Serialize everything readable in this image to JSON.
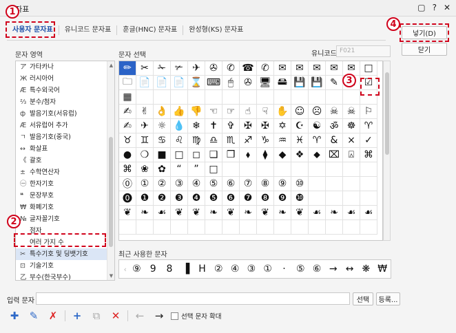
{
  "window": {
    "title": "문자표",
    "help_icon_label": "?"
  },
  "tabs": [
    {
      "label": "사용자 문자표"
    },
    {
      "label": "유니코드 문자표"
    },
    {
      "label": "훈글(HNC) 문자표"
    },
    {
      "label": "완성형(KS) 문자표"
    }
  ],
  "area_label": "문자 영역",
  "select_label": "문자 선택",
  "unicode": {
    "label": "유니코드",
    "value": "F021"
  },
  "categories": [
    {
      "icon": "ア",
      "label": "가타카나"
    },
    {
      "icon": "Ж",
      "label": "러시아어"
    },
    {
      "icon": "Æ",
      "label": "특수외국어"
    },
    {
      "icon": "⅔",
      "label": "분수/첨자"
    },
    {
      "icon": "ф",
      "label": "발음기호(서유럽)"
    },
    {
      "icon": "Æ",
      "label": "서유럽어 추가"
    },
    {
      "icon": "ㄱ",
      "label": "발음기호(중국)"
    },
    {
      "icon": "↔",
      "label": "화살표"
    },
    {
      "icon": "《",
      "label": "괄호"
    },
    {
      "icon": "±",
      "label": "수학연산자"
    },
    {
      "icon": "㊀",
      "label": "한자기호"
    },
    {
      "icon": "❝",
      "label": "문장부호"
    },
    {
      "icon": "₩",
      "label": "화폐기호"
    },
    {
      "icon": "№",
      "label": "글자꼴기호"
    },
    {
      "icon": "",
      "label": "점자"
    },
    {
      "icon": "",
      "label": "여러 가지 수"
    },
    {
      "icon": "✂",
      "label": "특수기호 및 딩뱃기호"
    },
    {
      "icon": "⊡",
      "label": "기술기호"
    },
    {
      "icon": "乙",
      "label": "부수(한국부수)"
    },
    {
      "icon": "丿",
      "label": "부수(한중일부수추가)"
    }
  ],
  "symbols": [
    "✏",
    "✂",
    "✁",
    "✃",
    "✈",
    "✇",
    "✆",
    "☎",
    "✆",
    "✉",
    "✉",
    "✉",
    "✉",
    "✉",
    "□",
    "🗀",
    "📄",
    "📄",
    "📄",
    "⌛",
    "⌨",
    "🖱",
    "✇",
    "🖥",
    "🖴",
    "💾",
    "💾",
    "✎",
    "☒",
    "☑",
    "▦",
    "",
    "",
    "",
    "",
    "",
    "",
    "",
    "",
    "",
    "",
    "",
    "",
    "",
    "",
    "✍",
    "✌",
    "👌",
    "👍",
    "👎",
    "☜",
    "☞",
    "☝",
    "☟",
    "✋",
    "☺",
    "☹",
    "☠",
    "☠",
    "⚐",
    "✍",
    "✈",
    "☼",
    "💧",
    "❄",
    "✝",
    "✞",
    "✠",
    "✠",
    "✡",
    "☪",
    "☯",
    "ॐ",
    "☸",
    "♈",
    "♉",
    "♊",
    "♋",
    "♌",
    "♍",
    "♎",
    "♏",
    "♐",
    "♑",
    "♒",
    "♓",
    "♈",
    "&",
    "×",
    "✓",
    "●",
    "❍",
    "■",
    "□",
    "◻",
    "❑",
    "❒",
    "⬧",
    "⧫",
    "◆",
    "❖",
    "⬥",
    "⌧",
    "⍓",
    "⌘",
    "⌘",
    "❀",
    "✿",
    "“",
    "”",
    "□",
    "",
    "",
    "",
    "",
    "",
    "",
    "",
    "",
    "",
    "⓪",
    "①",
    "②",
    "③",
    "④",
    "⑤",
    "⑥",
    "⑦",
    "⑧",
    "⑨",
    "⑩",
    "",
    "",
    "",
    "",
    "⓿",
    "❶",
    "❷",
    "❸",
    "❹",
    "❺",
    "❻",
    "❼",
    "❽",
    "❾",
    "❿",
    "",
    "",
    "",
    "",
    "❦",
    "❧",
    "☙",
    "❦",
    "❦",
    "❧",
    "❦",
    "❧",
    "❦",
    "❧",
    "❦",
    "☙",
    "❧",
    "☙",
    "☙",
    "",
    "",
    "",
    "",
    "",
    "",
    "",
    "",
    "",
    "",
    "",
    "",
    "",
    "",
    ""
  ],
  "recent_label": "최근 사용한 문자",
  "recent_chars": [
    "⑨",
    "9",
    "8",
    "▐",
    "H",
    "②",
    "④",
    "③",
    "①",
    "·",
    "⑤",
    "⑥",
    "→",
    "↔",
    "❋",
    "₩"
  ],
  "buttons": {
    "insert": "넣기(D)",
    "close": "닫기",
    "select": "선택",
    "register": "등록..."
  },
  "input_label": "입력 문자",
  "enlarge_label": "선택 문자 확대",
  "annotations": [
    "1",
    "2",
    "3",
    "4"
  ],
  "colors": {
    "annotation": "#d0021b",
    "selection": "#2b63c7",
    "active_tab": "#1c4fa8"
  }
}
